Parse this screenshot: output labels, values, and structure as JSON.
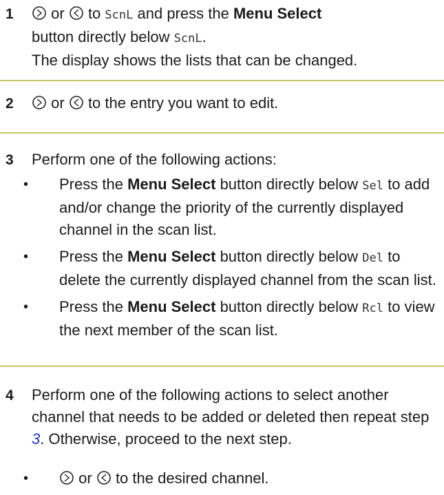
{
  "step1": {
    "number": "1",
    "or": "or",
    "to": "to",
    "lcd": "ScnL",
    "and_press": "and press the",
    "menu_select": "Menu Select",
    "button_below": "button directly below",
    "lcd2": "ScnL",
    "period": ".",
    "result": "The display shows the lists that can be changed."
  },
  "step2": {
    "number": "2",
    "or": "or",
    "rest": "to the entry you want to edit."
  },
  "step3": {
    "number": "3",
    "intro": "Perform one of the following actions:",
    "bullets": [
      {
        "pre": "Press the",
        "bold": "Menu Select",
        "post": "button directly below",
        "lcd": "Sel",
        "tail": "to add and/or change the priority of the currently displayed channel in the scan list."
      },
      {
        "pre": "Press the",
        "bold": "Menu Select",
        "post": "button directly below",
        "lcd": "Del",
        "tail": "to delete the currently displayed channel from the scan list."
      },
      {
        "pre": "Press the",
        "bold": "Menu Select",
        "post": "button directly below",
        "lcd": "Rcl",
        "tail": "to view the next member of the scan list."
      }
    ]
  },
  "step4": {
    "number": "4",
    "text_a": "Perform one of the following actions to select another channel that needs to be added or deleted then repeat step",
    "link": "3",
    "text_b": ". Otherwise, proceed to the next step.",
    "bullet_or": "or",
    "bullet_rest": "to the desired channel."
  },
  "icons": {
    "right": "right-arrow-button-icon",
    "left": "left-arrow-button-icon"
  },
  "colors": {
    "rule": "#c8c36a",
    "link": "#2233cc"
  }
}
